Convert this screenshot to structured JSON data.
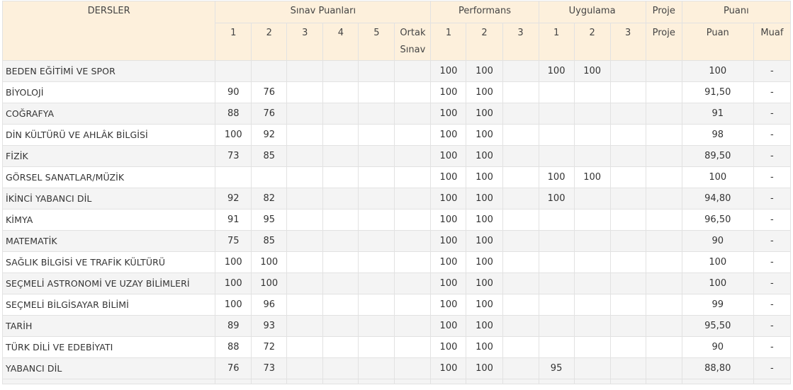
{
  "header": {
    "dersler": "DERSLER",
    "sinav_group": "Sınav Puanları",
    "performans_group": "Performans",
    "uygulama_group": "Uygulama",
    "proje_group": "Proje",
    "puani_group": "Puanı",
    "sinav_cols": [
      "1",
      "2",
      "3",
      "4",
      "5",
      "Ortak Sınav"
    ],
    "performans_cols": [
      "1",
      "2",
      "3"
    ],
    "uygulama_cols": [
      "1",
      "2",
      "3"
    ],
    "proje_col": "Proje",
    "puan_col": "Puan",
    "muaf_col": "Muaf"
  },
  "rows": [
    {
      "ders": "BEDEN EĞİTİMİ VE SPOR",
      "s1": "",
      "s2": "",
      "s3": "",
      "s4": "",
      "s5": "",
      "ortak": "",
      "p1": "100",
      "p2": "100",
      "p3": "",
      "u1": "100",
      "u2": "100",
      "u3": "",
      "proje": "",
      "puan": "100",
      "muaf": "-"
    },
    {
      "ders": "BİYOLOJİ",
      "s1": "90",
      "s2": "76",
      "s3": "",
      "s4": "",
      "s5": "",
      "ortak": "",
      "p1": "100",
      "p2": "100",
      "p3": "",
      "u1": "",
      "u2": "",
      "u3": "",
      "proje": "",
      "puan": "91,50",
      "muaf": "-"
    },
    {
      "ders": "COĞRAFYA",
      "s1": "88",
      "s2": "76",
      "s3": "",
      "s4": "",
      "s5": "",
      "ortak": "",
      "p1": "100",
      "p2": "100",
      "p3": "",
      "u1": "",
      "u2": "",
      "u3": "",
      "proje": "",
      "puan": "91",
      "muaf": "-"
    },
    {
      "ders": "DİN KÜLTÜRÜ VE AHLÂK BİLGİSİ",
      "s1": "100",
      "s2": "92",
      "s3": "",
      "s4": "",
      "s5": "",
      "ortak": "",
      "p1": "100",
      "p2": "100",
      "p3": "",
      "u1": "",
      "u2": "",
      "u3": "",
      "proje": "",
      "puan": "98",
      "muaf": "-"
    },
    {
      "ders": "FİZİK",
      "s1": "73",
      "s2": "85",
      "s3": "",
      "s4": "",
      "s5": "",
      "ortak": "",
      "p1": "100",
      "p2": "100",
      "p3": "",
      "u1": "",
      "u2": "",
      "u3": "",
      "proje": "",
      "puan": "89,50",
      "muaf": "-"
    },
    {
      "ders": "GÖRSEL SANATLAR/MÜZİK",
      "s1": "",
      "s2": "",
      "s3": "",
      "s4": "",
      "s5": "",
      "ortak": "",
      "p1": "100",
      "p2": "100",
      "p3": "",
      "u1": "100",
      "u2": "100",
      "u3": "",
      "proje": "",
      "puan": "100",
      "muaf": "-"
    },
    {
      "ders": "İKİNCİ YABANCI DİL",
      "s1": "92",
      "s2": "82",
      "s3": "",
      "s4": "",
      "s5": "",
      "ortak": "",
      "p1": "100",
      "p2": "100",
      "p3": "",
      "u1": "100",
      "u2": "",
      "u3": "",
      "proje": "",
      "puan": "94,80",
      "muaf": "-"
    },
    {
      "ders": "KİMYA",
      "s1": "91",
      "s2": "95",
      "s3": "",
      "s4": "",
      "s5": "",
      "ortak": "",
      "p1": "100",
      "p2": "100",
      "p3": "",
      "u1": "",
      "u2": "",
      "u3": "",
      "proje": "",
      "puan": "96,50",
      "muaf": "-"
    },
    {
      "ders": "MATEMATİK",
      "s1": "75",
      "s2": "85",
      "s3": "",
      "s4": "",
      "s5": "",
      "ortak": "",
      "p1": "100",
      "p2": "100",
      "p3": "",
      "u1": "",
      "u2": "",
      "u3": "",
      "proje": "",
      "puan": "90",
      "muaf": "-"
    },
    {
      "ders": "SAĞLIK BİLGİSİ VE TRAFİK KÜLTÜRÜ",
      "s1": "100",
      "s2": "100",
      "s3": "",
      "s4": "",
      "s5": "",
      "ortak": "",
      "p1": "100",
      "p2": "100",
      "p3": "",
      "u1": "",
      "u2": "",
      "u3": "",
      "proje": "",
      "puan": "100",
      "muaf": "-"
    },
    {
      "ders": "SEÇMELİ ASTRONOMİ VE UZAY BİLİMLERİ",
      "s1": "100",
      "s2": "100",
      "s3": "",
      "s4": "",
      "s5": "",
      "ortak": "",
      "p1": "100",
      "p2": "100",
      "p3": "",
      "u1": "",
      "u2": "",
      "u3": "",
      "proje": "",
      "puan": "100",
      "muaf": "-"
    },
    {
      "ders": "SEÇMELİ BİLGİSAYAR BİLİMİ",
      "s1": "100",
      "s2": "96",
      "s3": "",
      "s4": "",
      "s5": "",
      "ortak": "",
      "p1": "100",
      "p2": "100",
      "p3": "",
      "u1": "",
      "u2": "",
      "u3": "",
      "proje": "",
      "puan": "99",
      "muaf": "-"
    },
    {
      "ders": "TARİH",
      "s1": "89",
      "s2": "93",
      "s3": "",
      "s4": "",
      "s5": "",
      "ortak": "",
      "p1": "100",
      "p2": "100",
      "p3": "",
      "u1": "",
      "u2": "",
      "u3": "",
      "proje": "",
      "puan": "95,50",
      "muaf": "-"
    },
    {
      "ders": "TÜRK DİLİ VE EDEBİYATI",
      "s1": "88",
      "s2": "72",
      "s3": "",
      "s4": "",
      "s5": "",
      "ortak": "",
      "p1": "100",
      "p2": "100",
      "p3": "",
      "u1": "",
      "u2": "",
      "u3": "",
      "proje": "",
      "puan": "90",
      "muaf": "-"
    },
    {
      "ders": "YABANCI DİL",
      "s1": "76",
      "s2": "73",
      "s3": "",
      "s4": "",
      "s5": "",
      "ortak": "",
      "p1": "100",
      "p2": "100",
      "p3": "",
      "u1": "95",
      "u2": "",
      "u3": "",
      "proje": "",
      "puan": "88,80",
      "muaf": "-"
    }
  ]
}
